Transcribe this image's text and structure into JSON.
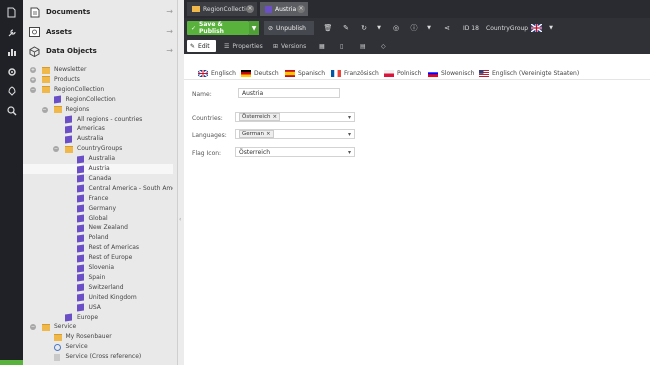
{
  "leftbar": {
    "icons": [
      "file-icon",
      "wrench-icon",
      "bar-chart-icon",
      "gear-icon",
      "rocket-icon",
      "search-icon"
    ]
  },
  "sidebar": {
    "panels": {
      "documents": "Documents",
      "assets": "Assets",
      "data_objects": "Data Objects"
    },
    "tree": [
      "Newsletter",
      "Products",
      "RegionCollection",
      "RegionCollection",
      "Regions",
      "All regions - countries",
      "Americas",
      "Australia",
      "CountryGroups",
      "Australia",
      "Austria",
      "Canada",
      "Central America - South America",
      "France",
      "Germany",
      "Global",
      "New Zealand",
      "Poland",
      "Rest of Americas",
      "Rest of Europe",
      "Slovenia",
      "Spain",
      "Switzerland",
      "United Kingdom",
      "USA",
      "Europe",
      "Service",
      "My Rosenbauer",
      "Service",
      "Service (Cross reference)"
    ]
  },
  "tabs": [
    "RegionCollection",
    "Austria"
  ],
  "toolbar": {
    "save_publish": "Save & Publish",
    "unpublish": "Unpublish",
    "id_label": "ID 18",
    "class_name": "CountryGroup"
  },
  "subtabs": [
    "Edit",
    "Properties",
    "Versions"
  ],
  "languages": [
    "Englisch",
    "Deutsch",
    "Spanisch",
    "Französisch",
    "Polnisch",
    "Slowenisch",
    "Englisch (Vereinigte Staaten)"
  ],
  "form": {
    "name_label": "Name:",
    "name_value": "Austria",
    "countries_label": "Countries:",
    "countries_value": "Österreich",
    "languages_label": "Languages:",
    "languages_value": "German",
    "flag_label": "Flag Icon:",
    "flag_value": "Österreich"
  },
  "colors": {
    "accent_green": "#58b23c",
    "toolbar_dark": "#2f3136",
    "leftbar_dark": "#1f2126",
    "object_purple": "#6b4fc7",
    "folder_yellow": "#f0b84a"
  }
}
